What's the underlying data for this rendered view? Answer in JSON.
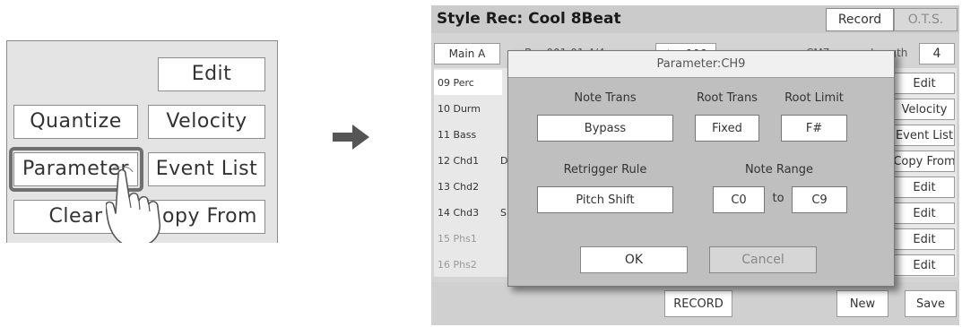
{
  "zoom": {
    "edit": "Edit",
    "quantize": "Quantize",
    "velocity": "Velocity",
    "parameter": "Parameter",
    "event_list": "Event List",
    "clear": "Clear",
    "copy_from": "opy From"
  },
  "screen": {
    "title": "Style Rec: Cool 8Beat",
    "tabs": {
      "record": "Record",
      "ots": "O.T.S."
    },
    "info": {
      "section": "Main A",
      "bar": "Bar 001:01  4/4",
      "tempo": "♩ = 106",
      "chord": "CM7",
      "length_label": "Length",
      "length_value": "4"
    },
    "tracks": [
      "09 Perc",
      "10 Durm",
      "11 Bass",
      "12 Chd1",
      "13 Chd2",
      "14 Chd3",
      "15 Phs1",
      "16 Phs2"
    ],
    "row_letters": {
      "row4": "D",
      "row6": "S"
    },
    "side_buttons": [
      "Edit",
      "Velocity",
      "Event List",
      "Copy From",
      "Edit",
      "Edit",
      "Edit",
      "Edit"
    ],
    "bottom": {
      "record": "RECORD",
      "new": "New",
      "save": "Save"
    }
  },
  "dialog": {
    "title": "Parameter:CH9",
    "note_trans_label": "Note Trans",
    "note_trans_value": "Bypass",
    "root_trans_label": "Root Trans",
    "root_trans_value": "Fixed",
    "root_limit_label": "Root Limit",
    "root_limit_value": "F#",
    "retrigger_label": "Retrigger Rule",
    "retrigger_value": "Pitch Shift",
    "note_range_label": "Note Range",
    "range_low": "C0",
    "range_to": "to",
    "range_high": "C9",
    "ok": "OK",
    "cancel": "Cancel"
  },
  "colors": {
    "screen_bg": "#d4d4d4",
    "dialog_bg": "#bfbfbf",
    "highlight": "#707070",
    "arrow": "#555555"
  }
}
